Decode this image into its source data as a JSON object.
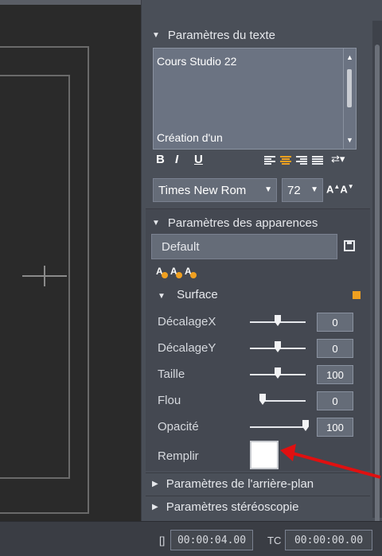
{
  "text_settings": {
    "header": "Paramètres du texte",
    "lines": [
      "Cours Studio 22",
      "Création d'un"
    ],
    "format_buttons": [
      "B",
      "I",
      "U"
    ],
    "font_family": "Times New Rom",
    "font_size": "72"
  },
  "appearance_settings": {
    "header": "Paramètres des apparences",
    "preset": "Default",
    "surface": {
      "header": "Surface",
      "accent_color": "#f0a020",
      "params": [
        {
          "label": "DécalageX",
          "value": "0",
          "level": 0.5
        },
        {
          "label": "DécalageY",
          "value": "0",
          "level": 0.5
        },
        {
          "label": "Taille",
          "value": "100",
          "level": 0.5
        },
        {
          "label": "Flou",
          "value": "0",
          "level": 0.0
        },
        {
          "label": "Opacité",
          "value": "100",
          "level": 1.0
        }
      ],
      "fill_label": "Remplir",
      "fill_color": "#ffffff"
    }
  },
  "background_settings": {
    "header": "Paramètres de l'arrière-plan"
  },
  "stereo_settings": {
    "header": "Paramètres stéréoscopie"
  },
  "statusbar": {
    "duration_glyph": "[]",
    "duration": "00:00:04.00",
    "tc_label": "TC",
    "timecode": "00:00:00.00"
  },
  "annotation_color": "#e01010"
}
